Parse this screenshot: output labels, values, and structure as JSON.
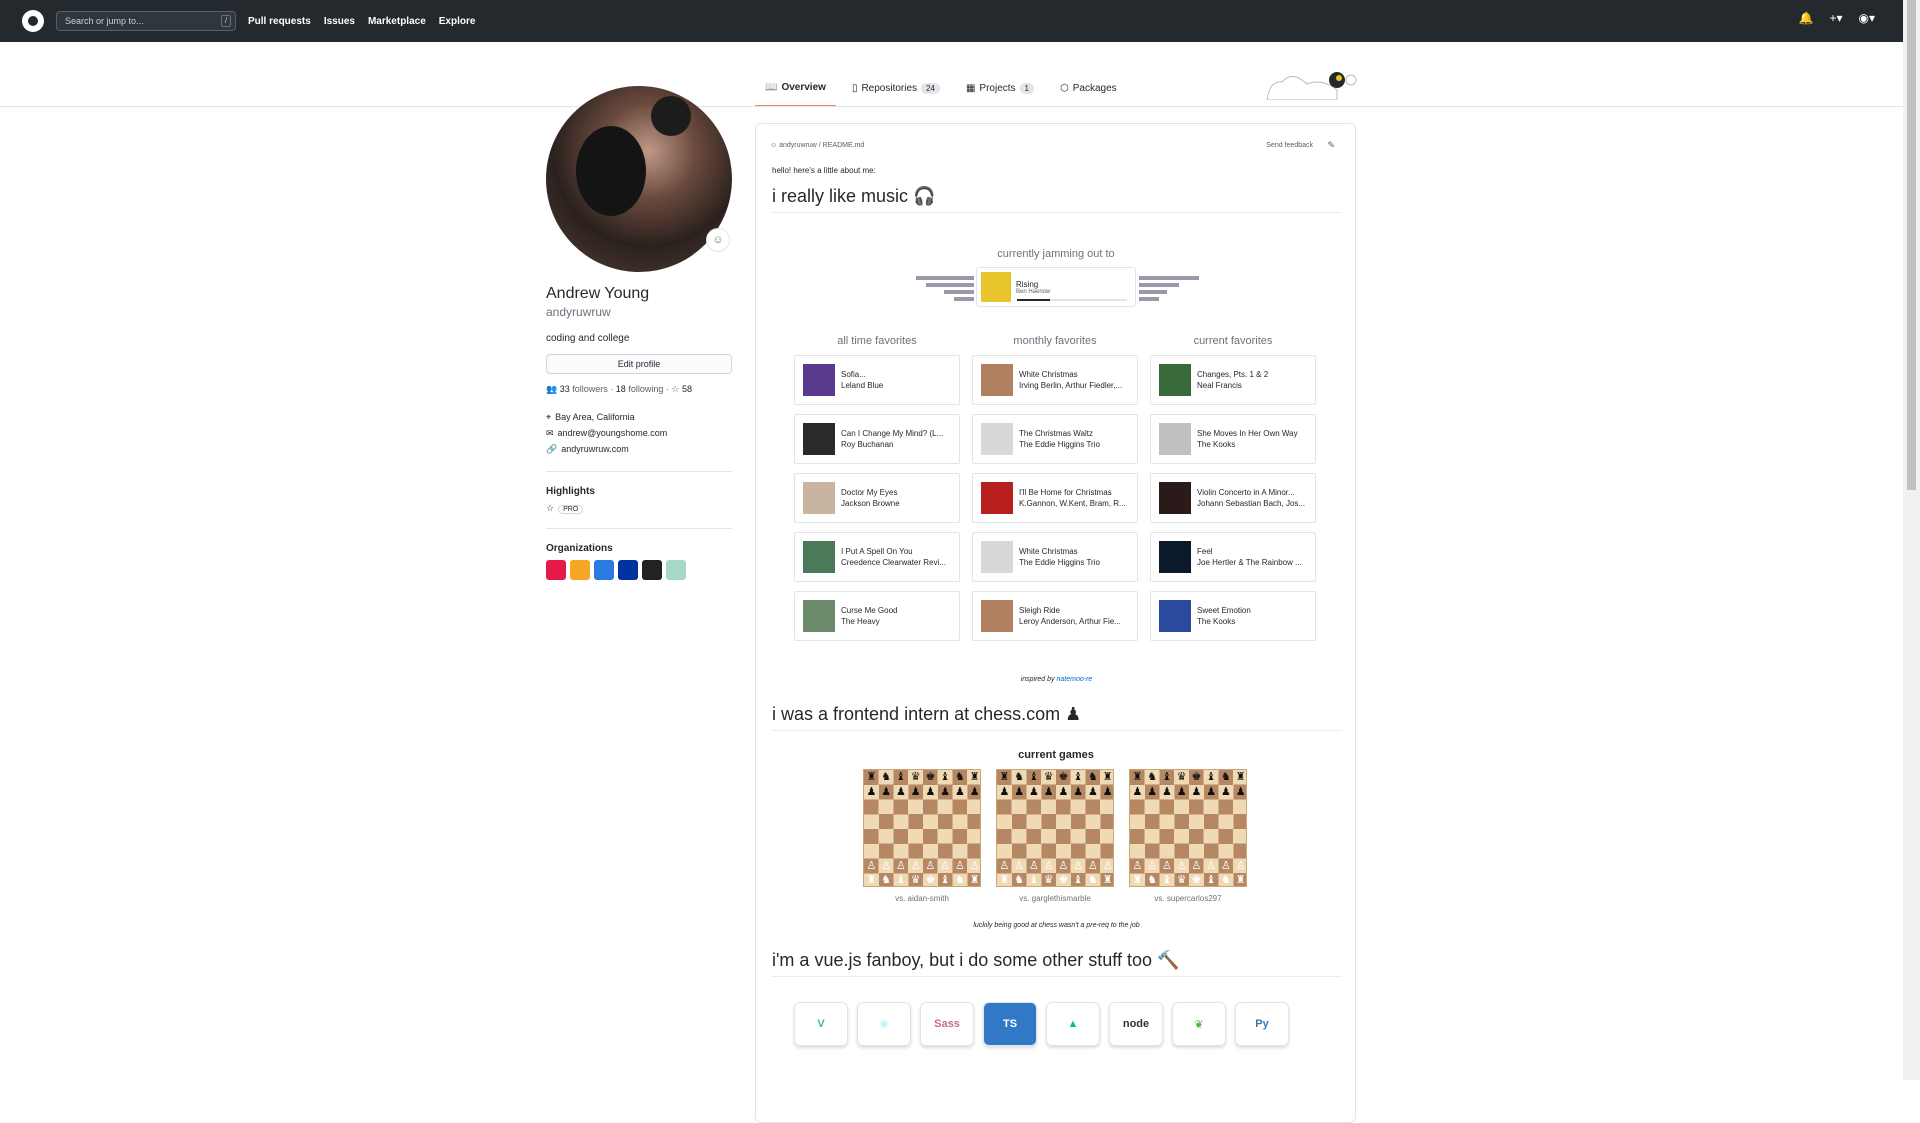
{
  "nav": {
    "search_placeholder": "Search or jump to...",
    "slash": "/",
    "links": [
      "Pull requests",
      "Issues",
      "Marketplace",
      "Explore"
    ]
  },
  "tabs": [
    {
      "label": "Overview"
    },
    {
      "label": "Repositories",
      "count": "24"
    },
    {
      "label": "Projects",
      "count": "1"
    },
    {
      "label": "Packages"
    }
  ],
  "profile": {
    "name": "Andrew Young",
    "login": "andyruwruw",
    "bio": "coding and college",
    "edit_label": "Edit profile",
    "followers": "33",
    "followers_label": "followers",
    "following": "18",
    "following_label": "following",
    "stars": "58",
    "location": "Bay Area, California",
    "email": "andrew@youngshome.com",
    "website": "andyruwruw.com"
  },
  "highlights": {
    "title": "Highlights",
    "badge": "PRO"
  },
  "organizations": {
    "title": "Organizations",
    "colors": [
      "#e6194b",
      "#f5a623",
      "#2a7ae2",
      "#0033a0",
      "#222222",
      "#a8d8c8"
    ]
  },
  "readme": {
    "path": "andyruwruw / README.md",
    "feedback": "Send feedback",
    "intro": "hello! here's a little about me:",
    "music_heading": "i really like music 🎧",
    "jamming_title": "currently jamming out to",
    "now_playing": {
      "title": "Rising",
      "artist": "Ben Haenow",
      "progress": 0.3
    },
    "columns": [
      {
        "title": "all time favorites",
        "tracks": [
          {
            "title": "Sofia...",
            "artist": "Leland Blue",
            "color": "#5a3a8c"
          },
          {
            "title": "Can I Change My Mind? (L...",
            "artist": "Roy Buchanan",
            "color": "#2a2a2a"
          },
          {
            "title": "Doctor My Eyes",
            "artist": "Jackson Browne",
            "color": "#c8b4a0"
          },
          {
            "title": "I Put A Spell On You",
            "artist": "Creedence Clearwater Revi...",
            "color": "#4a7a5a"
          },
          {
            "title": "Curse Me Good",
            "artist": "The Heavy",
            "color": "#6a8a6a"
          }
        ]
      },
      {
        "title": "monthly favorites",
        "tracks": [
          {
            "title": "White Christmas",
            "artist": "Irving Berlin, Arthur Fiedler,...",
            "color": "#b08060"
          },
          {
            "title": "The Christmas Waltz",
            "artist": "The Eddie Higgins Trio",
            "color": "#d8d8d8"
          },
          {
            "title": "I'll Be Home for Christmas",
            "artist": "K.Gannon, W.Kent, Bram, R...",
            "color": "#b82020"
          },
          {
            "title": "White Christmas",
            "artist": "The Eddie Higgins Trio",
            "color": "#d8d8d8"
          },
          {
            "title": "Sleigh Ride",
            "artist": "Leroy Anderson, Arthur Fie...",
            "color": "#b08060"
          }
        ]
      },
      {
        "title": "current favorites",
        "tracks": [
          {
            "title": "Changes, Pts. 1 & 2",
            "artist": "Neal Francis",
            "color": "#3a6a3a"
          },
          {
            "title": "She Moves In Her Own Way",
            "artist": "The Kooks",
            "color": "#c0c0c0"
          },
          {
            "title": "Violin Concerto in A Minor...",
            "artist": "Johann Sebastian Bach, Jos...",
            "color": "#2a1a1a"
          },
          {
            "title": "Feel",
            "artist": "Joe Hertler & The Rainbow ...",
            "color": "#0a1a2a"
          },
          {
            "title": "Sweet Emotion",
            "artist": "The Kooks",
            "color": "#2a4aa0"
          }
        ]
      }
    ],
    "inspired_prefix": "inspired by",
    "inspired_name": "natemoo-re",
    "chess_heading": "i was a frontend intern at chess.com ♟",
    "games_title": "current games",
    "games": [
      {
        "opponent": "vs. aidan-smith"
      },
      {
        "opponent": "vs. garglethismarble"
      },
      {
        "opponent": "vs. supercarlos297"
      }
    ],
    "chess_caption": "luckily being good at chess wasn't a pre-req to the job",
    "tech_heading": "i'm a vue.js fanboy, but i do some other stuff too 🔨",
    "tech": [
      {
        "label": "V",
        "color": "#41b883"
      },
      {
        "label": "⚛",
        "color": "#61dafb"
      },
      {
        "label": "Sass",
        "color": "#cc6699"
      },
      {
        "label": "TS",
        "color": "#ffffff"
      },
      {
        "label": "▲",
        "color": "#00c58e"
      },
      {
        "label": "node",
        "color": "#333333"
      },
      {
        "label": "❦",
        "color": "#4db33d"
      },
      {
        "label": "Py",
        "color": "#3776ab"
      }
    ]
  }
}
